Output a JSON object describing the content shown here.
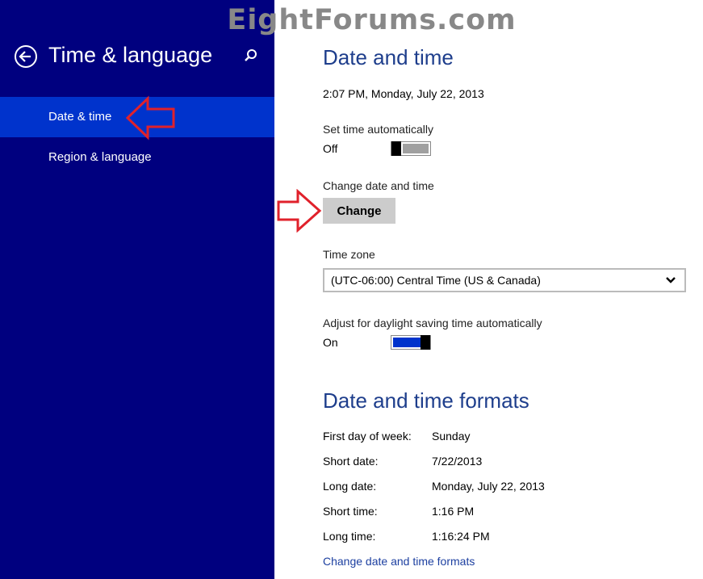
{
  "watermark": "EightForums.com",
  "sidebar": {
    "title": "Time & language",
    "items": [
      {
        "label": "Date & time",
        "selected": true
      },
      {
        "label": "Region & language",
        "selected": false
      }
    ]
  },
  "main": {
    "section1_title": "Date and time",
    "current_datetime": "2:07 PM, Monday, July 22, 2013",
    "set_time_auto": {
      "label": "Set time automatically",
      "state": "Off",
      "on": false
    },
    "change_datetime": {
      "label": "Change date and time",
      "button": "Change"
    },
    "time_zone": {
      "label": "Time zone",
      "value": "(UTC-06:00) Central Time (US & Canada)"
    },
    "dst": {
      "label": "Adjust for daylight saving time automatically",
      "state": "On",
      "on": true
    },
    "section2_title": "Date and time formats",
    "formats": [
      {
        "label": "First day of week:",
        "value": "Sunday"
      },
      {
        "label": "Short date:",
        "value": "7/22/2013"
      },
      {
        "label": "Long date:",
        "value": "Monday, July 22, 2013"
      },
      {
        "label": "Short time:",
        "value": "1:16 PM"
      },
      {
        "label": "Long time:",
        "value": "1:16:24 PM"
      }
    ],
    "formats_link": "Change date and time formats"
  },
  "colors": {
    "sidebar_bg": "#00007f",
    "selected_bg": "#0033cc",
    "heading": "#1e3e8c",
    "toggle_on": "#0033cc",
    "toggle_off": "#a0a0a0",
    "annotation_arrow": "#e0212b"
  },
  "icons": [
    "back-arrow-icon",
    "search-icon",
    "chevron-down-icon",
    "annotation-arrow-icon"
  ]
}
